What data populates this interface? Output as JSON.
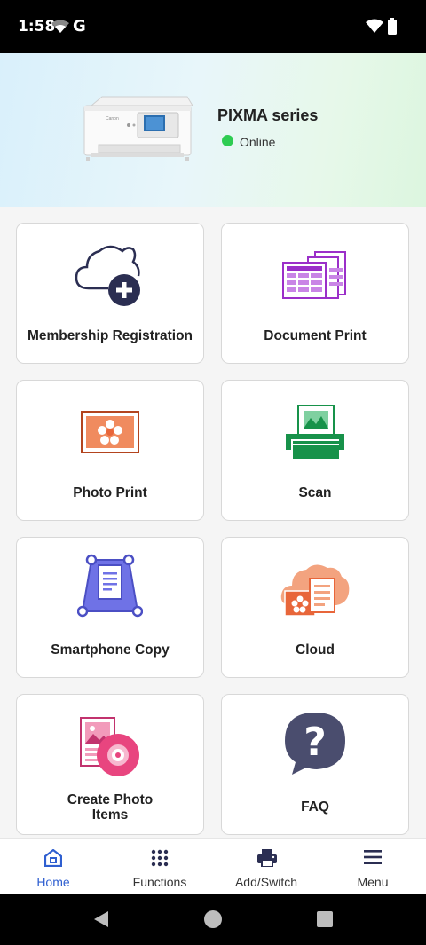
{
  "status_bar": {
    "time": "1:58",
    "carrier_letter": "G"
  },
  "printer": {
    "name": "PIXMA series",
    "status": "Online",
    "status_color": "#2ecc52"
  },
  "cards": [
    {
      "label": "Membership Registration",
      "icon": "cloud-plus-icon"
    },
    {
      "label": "Document Print",
      "icon": "document-print-icon"
    },
    {
      "label": "Photo Print",
      "icon": "photo-print-icon"
    },
    {
      "label": "Scan",
      "icon": "scan-icon"
    },
    {
      "label": "Smartphone Copy",
      "icon": "smartphone-copy-icon"
    },
    {
      "label": "Cloud",
      "icon": "cloud-icon"
    },
    {
      "label_line1": "Create Photo",
      "label_line2": "Items",
      "icon": "create-photo-items-icon"
    },
    {
      "label": "FAQ",
      "icon": "faq-icon"
    }
  ],
  "bottom_nav": [
    {
      "label": "Home",
      "icon": "home-icon",
      "active": true
    },
    {
      "label": "Functions",
      "icon": "grid-icon",
      "active": false
    },
    {
      "label": "Add/Switch",
      "icon": "printer-icon",
      "active": false
    },
    {
      "label": "Menu",
      "icon": "menu-icon",
      "active": false
    }
  ],
  "colors": {
    "accent": "#2f5fd0",
    "purple": "#9b2fc9",
    "orange": "#e8663a",
    "green": "#17924a",
    "navy": "#2b2e52"
  }
}
